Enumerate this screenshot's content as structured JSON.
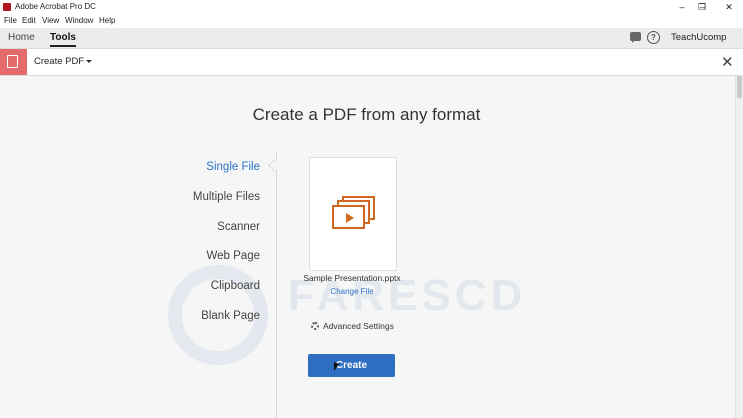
{
  "window": {
    "title": "Adobe Acrobat Pro DC",
    "controls": [
      "✕",
      "❐",
      "–"
    ]
  },
  "menu": [
    "File",
    "Edit",
    "View",
    "Window",
    "Help"
  ],
  "nav": {
    "tabs": [
      "Home",
      "Tools"
    ],
    "active_tab": "Tools",
    "user": "TeachUcomp"
  },
  "toolbar": {
    "tool_name": "Create PDF",
    "close_glyph": "✕"
  },
  "main": {
    "heading": "Create a PDF from any format",
    "left_nav": [
      "Single File",
      "Multiple Files",
      "Scanner",
      "Web Page",
      "Clipboard",
      "Blank Page"
    ],
    "selected_nav": "Single File",
    "file_name": "Sample Presentation.pptx",
    "change_file": "Change File",
    "advanced_settings": "Advanced Settings",
    "create_button": "Create"
  },
  "watermark": {
    "text": "FARESCD"
  },
  "colors": {
    "accent_blue": "#2f6fc2",
    "link_blue": "#2a72c6",
    "tool_red": "#e46b6b",
    "slides_orange": "#d0691f"
  }
}
